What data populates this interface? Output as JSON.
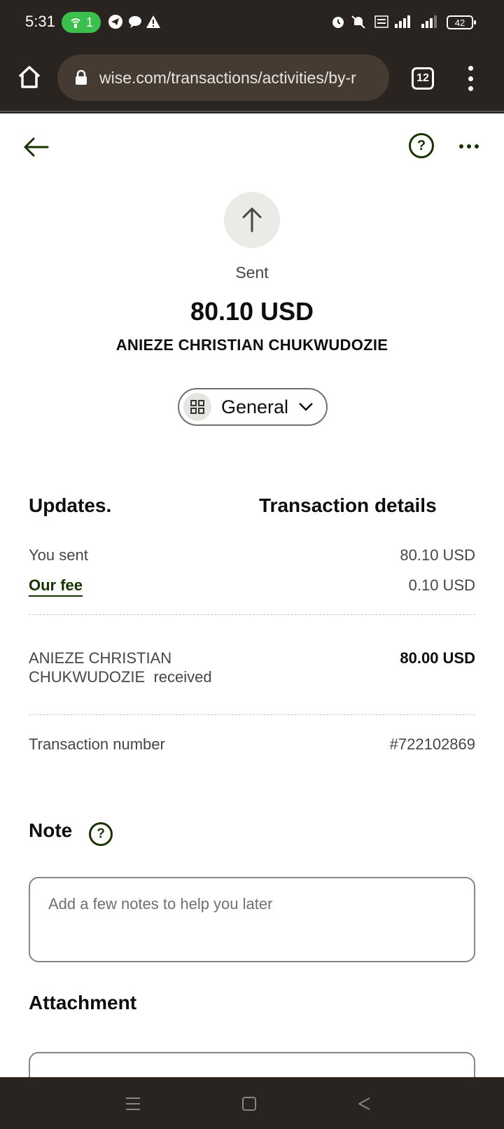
{
  "status_bar": {
    "time": "5:31",
    "hotspot_count": "1",
    "battery": "42"
  },
  "browser": {
    "url": "wise.com/transactions/activities/by-r",
    "tab_count": "12"
  },
  "header": {
    "back_icon": "arrow-left-icon",
    "help_icon": "question-icon",
    "more_icon": "more-horizontal-icon"
  },
  "summary": {
    "status": "Sent",
    "amount": "80.10 USD",
    "recipient": "ANIEZE CHRISTIAN CHUKWUDOZIE"
  },
  "category": {
    "label": "General"
  },
  "tabs": {
    "updates": "Updates.",
    "details": "Transaction details"
  },
  "details": {
    "you_sent_label": "You sent",
    "you_sent_value": "80.10 USD",
    "fee_label": "Our fee",
    "fee_value": "0.10 USD",
    "received_name_line1": "ANIEZE CHRISTIAN",
    "received_name_line2": "CHUKWUDOZIE",
    "received_word": "received",
    "received_value": "80.00 USD",
    "txn_label": "Transaction number",
    "txn_value": "#722102869"
  },
  "note": {
    "heading": "Note",
    "placeholder": "Add a few notes to help you later"
  },
  "attachment": {
    "heading": "Attachment"
  },
  "colors": {
    "accent": "#163300",
    "chrome": "#2a2420",
    "hotspot": "#3cc04d"
  }
}
